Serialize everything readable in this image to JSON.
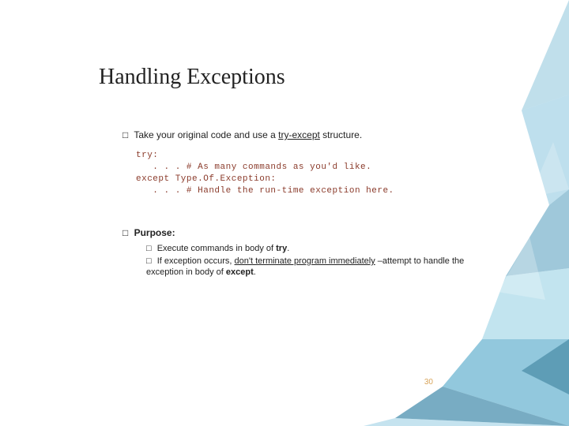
{
  "title": "Handling Exceptions",
  "bullet1": {
    "marker": "□",
    "pre": " Take your original code and use a ",
    "ul": "try-except",
    "post": " structure."
  },
  "code": {
    "l1": "try:",
    "l2": "   . . . # As many commands as you'd like.",
    "l3": "except Type.Of.Exception:",
    "l4": "   . . . # Handle the run-time exception here."
  },
  "bullet2": {
    "marker": "□",
    "label_strong": " Purpose:"
  },
  "sub1": {
    "marker": "□ ",
    "pre": " Execute commands in body of ",
    "strong": "try",
    "post": "."
  },
  "sub2": {
    "marker": "□ ",
    "pre": " If exception occurs, ",
    "ul": "don't terminate program immediately",
    "mid": " –attempt to handle the exception in body of ",
    "strong": "except",
    "post": "."
  },
  "page": "30"
}
